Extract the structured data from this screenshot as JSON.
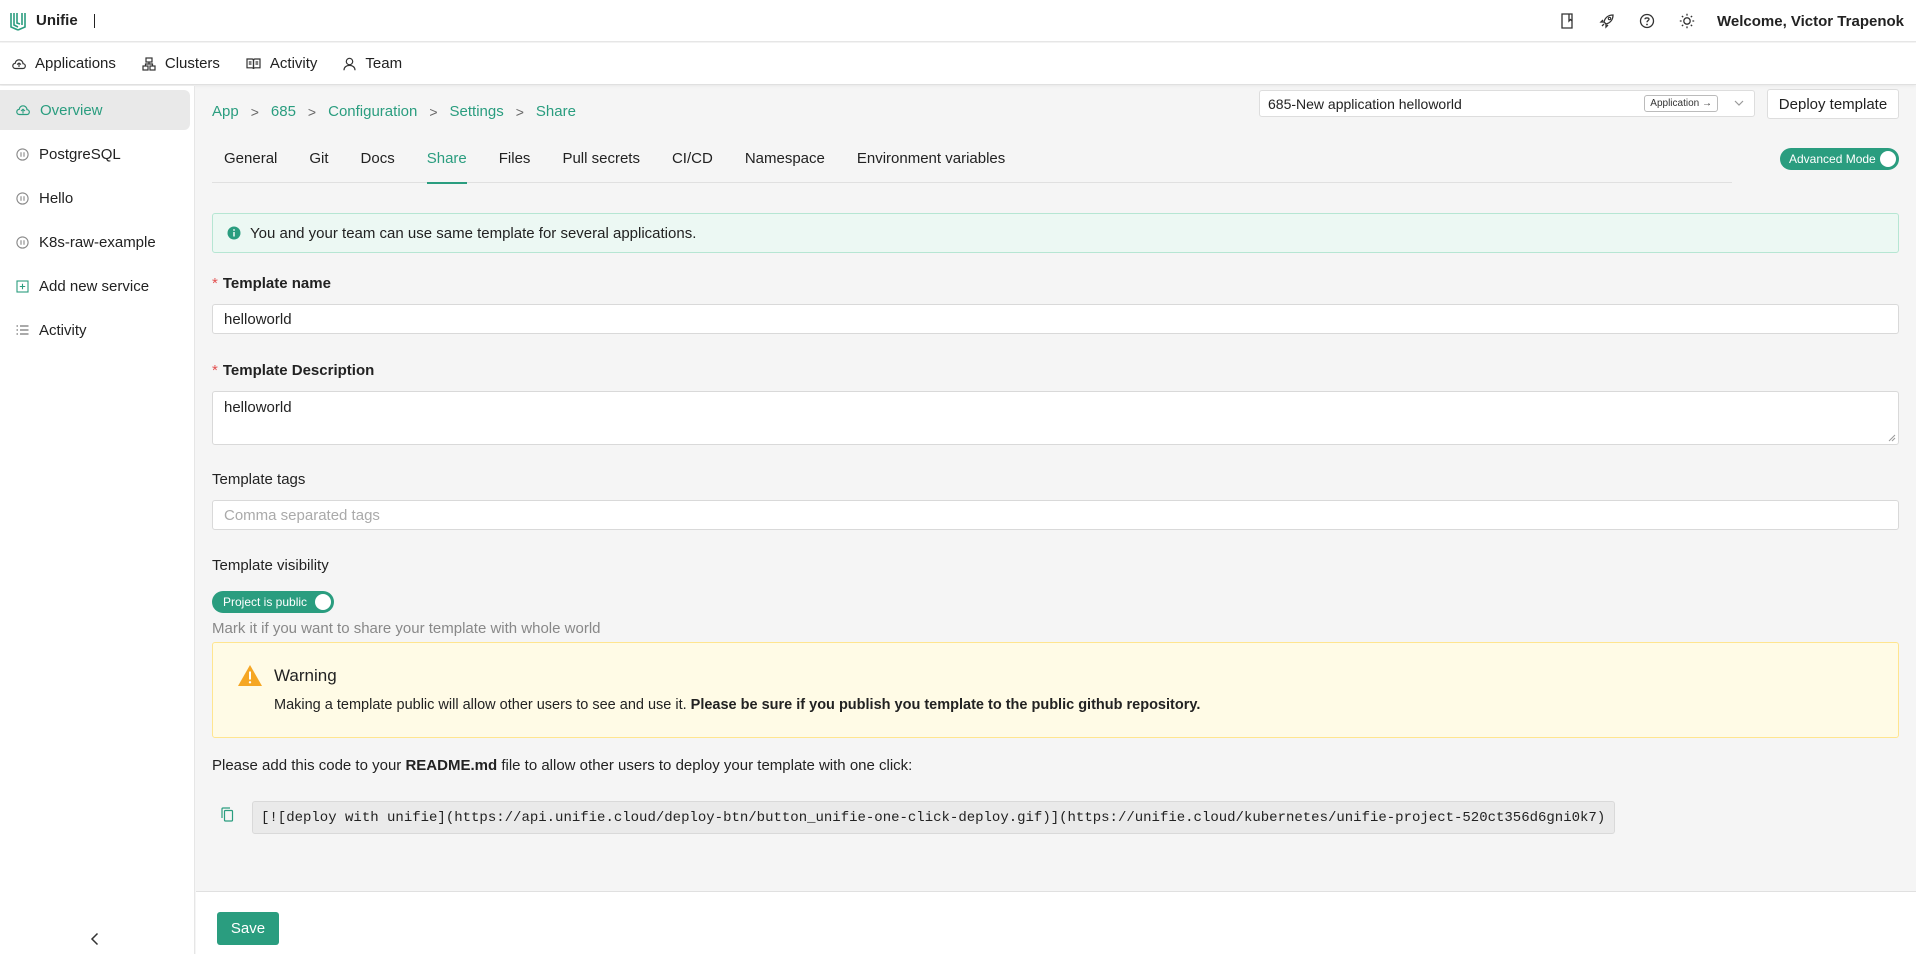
{
  "app": {
    "name": "Unifie",
    "welcome": "Welcome, Victor Trapenok"
  },
  "topbar_icons": [
    "book-icon",
    "rocket-icon",
    "help-icon",
    "theme-icon"
  ],
  "nav": [
    {
      "label": "Applications",
      "icon": "cloud-icon"
    },
    {
      "label": "Clusters",
      "icon": "cluster-icon"
    },
    {
      "label": "Activity",
      "icon": "book-open-icon"
    },
    {
      "label": "Team",
      "icon": "user-icon"
    }
  ],
  "sidebar": {
    "items": [
      {
        "label": "Overview",
        "icon": "cloud-upload-icon",
        "active": true
      },
      {
        "label": "PostgreSQL",
        "icon": "pause-circle-icon"
      },
      {
        "label": "Hello",
        "icon": "pause-circle-icon"
      },
      {
        "label": "K8s-raw-example",
        "icon": "pause-circle-icon"
      },
      {
        "label": "Add new service",
        "icon": "plus-square-icon"
      },
      {
        "label": "Activity",
        "icon": "list-icon"
      }
    ]
  },
  "breadcrumb": [
    "App",
    "685",
    "Configuration",
    "Settings",
    "Share"
  ],
  "app_select": {
    "value": "685-New application helloworld",
    "tag": "Application →"
  },
  "deploy_template": "Deploy template",
  "advanced_mode": "Advanced Mode",
  "tabs": [
    "General",
    "Git",
    "Docs",
    "Share",
    "Files",
    "Pull secrets",
    "CI/CD",
    "Namespace",
    "Environment variables"
  ],
  "active_tab": "Share",
  "info": "You and your team can use same template for several applications.",
  "form": {
    "name_label": "Template name",
    "name_value": "helloworld",
    "desc_label": "Template Description",
    "desc_value": "helloworld",
    "tags_label": "Template tags",
    "tags_placeholder": "Comma separated tags",
    "visibility_label": "Template visibility",
    "visibility_toggle": "Project is public",
    "visibility_hint": "Mark it if you want to share your template with whole world"
  },
  "warning": {
    "title": "Warning",
    "text": "Making a template public will allow other users to see and use it.",
    "bold": "Please be sure if you publish you template to the public github repository."
  },
  "readme": {
    "before": "Please add this code to your",
    "file": "README.md",
    "after": "file to allow other users to deploy your template with one click:",
    "code": "[![deploy with unifie](https://api.unifie.cloud/deploy-btn/button_unifie-one-click-deploy.gif)](https://unifie.cloud/kubernetes/unifie-project-520ct356d6gni0k7)"
  },
  "save": "Save",
  "colors": {
    "accent": "#2a9d7f",
    "warning_bg": "#fffbe6",
    "info_bg": "#ecf8f3"
  }
}
